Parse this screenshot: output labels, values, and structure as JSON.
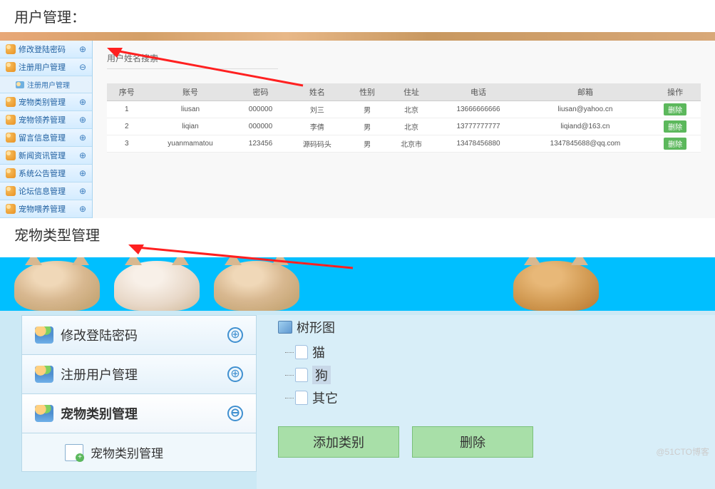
{
  "headings": {
    "user_mgmt": "用户管理：",
    "pet_type_mgmt": "宠物类型管理"
  },
  "sidebar1": {
    "items": [
      {
        "label": "修改登陆密码",
        "toggle": "⊕"
      },
      {
        "label": "注册用户管理",
        "toggle": "⊖"
      },
      {
        "label": "注册用户管理",
        "sub": true
      },
      {
        "label": "宠物类别管理",
        "toggle": "⊕"
      },
      {
        "label": "宠物领养管理",
        "toggle": "⊕"
      },
      {
        "label": "留言信息管理",
        "toggle": "⊕"
      },
      {
        "label": "新闻资讯管理",
        "toggle": "⊕"
      },
      {
        "label": "系统公告管理",
        "toggle": "⊕"
      },
      {
        "label": "论坛信息管理",
        "toggle": "⊕"
      },
      {
        "label": "宠物喂养管理",
        "toggle": "⊕"
      }
    ]
  },
  "search": {
    "label": "用户姓名搜索"
  },
  "table": {
    "headers": [
      "序号",
      "账号",
      "密码",
      "姓名",
      "性别",
      "住址",
      "电话",
      "邮箱",
      "操作"
    ],
    "rows": [
      {
        "seq": "1",
        "acct": "liusan",
        "pwd": "000000",
        "name": "刘三",
        "sex": "男",
        "addr": "北京",
        "phone": "13666666666",
        "email": "liusan@yahoo.cn",
        "op": "删除"
      },
      {
        "seq": "2",
        "acct": "liqian",
        "pwd": "000000",
        "name": "李倩",
        "sex": "男",
        "addr": "北京",
        "phone": "13777777777",
        "email": "liqiand@163.cn",
        "op": "删除"
      },
      {
        "seq": "3",
        "acct": "yuanmamatou",
        "pwd": "123456",
        "name": "源码码头",
        "sex": "男",
        "addr": "北京市",
        "phone": "13478456880",
        "email": "1347845688@qq.com",
        "op": "删除"
      }
    ]
  },
  "sidebar2": {
    "items": [
      {
        "label": "修改登陆密码",
        "toggle": "⊕"
      },
      {
        "label": "注册用户管理",
        "toggle": "⊕"
      },
      {
        "label": "宠物类别管理",
        "toggle": "⊖",
        "active": true
      },
      {
        "label": "宠物类别管理",
        "sub": true
      }
    ]
  },
  "tree": {
    "title": "树形图",
    "nodes": [
      {
        "label": "猫"
      },
      {
        "label": "狗",
        "selected": true
      },
      {
        "label": "其它"
      }
    ]
  },
  "buttons2": {
    "add": "添加类别",
    "del": "删除"
  },
  "watermark": "@51CTO博客"
}
